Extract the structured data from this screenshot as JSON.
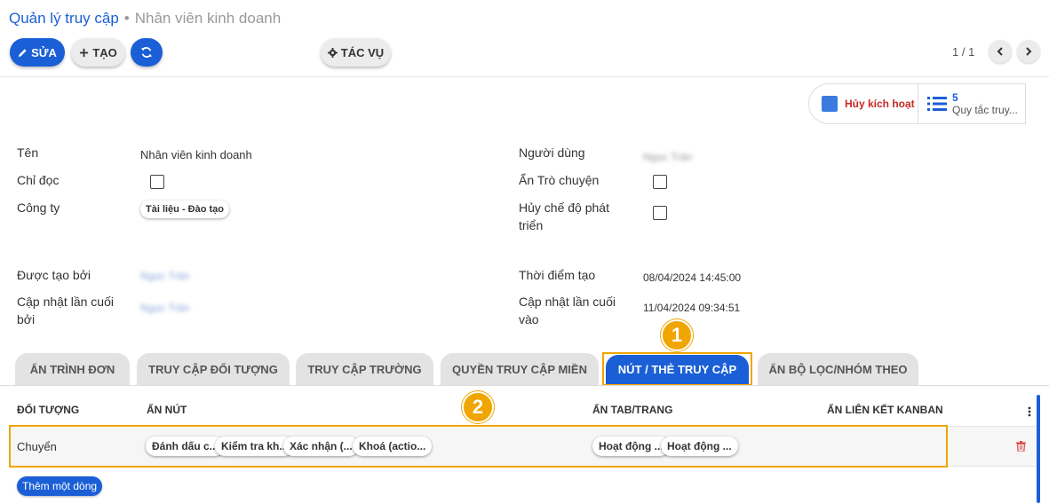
{
  "breadcrumb": {
    "root": "Quản lý truy cập",
    "separator": "•",
    "current": "Nhân viên kinh doanh"
  },
  "toolbar": {
    "edit_label": "SỬA",
    "create_label": "TẠO",
    "action_label": "TÁC VỤ",
    "pager": "1 / 1",
    "icons": {
      "edit": "pencil-icon",
      "create": "plus-icon",
      "refresh": "refresh-icon",
      "action": "gear-icon",
      "prev": "chevron-left-icon",
      "next": "chevron-right-icon"
    }
  },
  "smart_buttons": {
    "deactivate": {
      "label": "Hủy kích hoạt ở",
      "icon": "toggle-square-icon"
    },
    "rules": {
      "count": "5",
      "label": "Quy tắc truy...",
      "icon": "list-icon"
    }
  },
  "form": {
    "left": {
      "name_label": "Tên",
      "name_value": "Nhân viên kinh doanh",
      "readonly_label": "Chỉ đọc",
      "company_label": "Công ty",
      "company_tag": "Tài liệu - Đào tạo",
      "created_by_label": "Được tạo bởi",
      "created_by_value": "Ngọc Trân",
      "updated_by_label": "Cập nhật lần cuối bởi",
      "updated_by_value": "Ngọc Trân"
    },
    "right": {
      "user_label": "Người dùng",
      "user_value": "Ngọc Trân",
      "hide_chat_label": "Ẩn Trò chuyện",
      "disable_debug_label": "Hủy chế độ phát triển",
      "created_at_label": "Thời điểm tạo",
      "created_at_value": "08/04/2024 14:45:00",
      "updated_at_label": "Cập nhật lần cuối vào",
      "updated_at_value": "11/04/2024 09:34:51"
    }
  },
  "tabs": [
    {
      "label": "ẨN TRÌNH ĐƠN"
    },
    {
      "label": "TRUY CẬP ĐỐI TƯỢNG"
    },
    {
      "label": "TRUY CẬP TRƯỜNG"
    },
    {
      "label": "QUYỀN TRUY CẬP MIỀN"
    },
    {
      "label": "NÚT / THẺ TRUY CẬP",
      "active": true
    },
    {
      "label": "ẨN BỘ LỌC/NHÓM THEO"
    }
  ],
  "annotations": {
    "badge1": "1",
    "badge2": "2",
    "color": "#f0a500"
  },
  "table": {
    "columns": [
      "ĐỐI TƯỢNG",
      "ẨN NÚT",
      "ẨN TAB/TRANG",
      "ẨN LIÊN KẾT KANBAN"
    ],
    "rows": [
      {
        "object": "Chuyển",
        "hidden_buttons": [
          "Đánh dấu c...",
          "Kiểm tra kh...",
          "Xác nhận (...",
          "Khoá (actio..."
        ],
        "hidden_tabs": [
          "Hoạt động ...",
          "Hoạt động ..."
        ],
        "hidden_kanban": ""
      }
    ],
    "add_line": "Thêm một dòng"
  },
  "colors": {
    "primary": "#1a5fd6",
    "danger": "#c62828",
    "highlight": "#f0a500"
  }
}
